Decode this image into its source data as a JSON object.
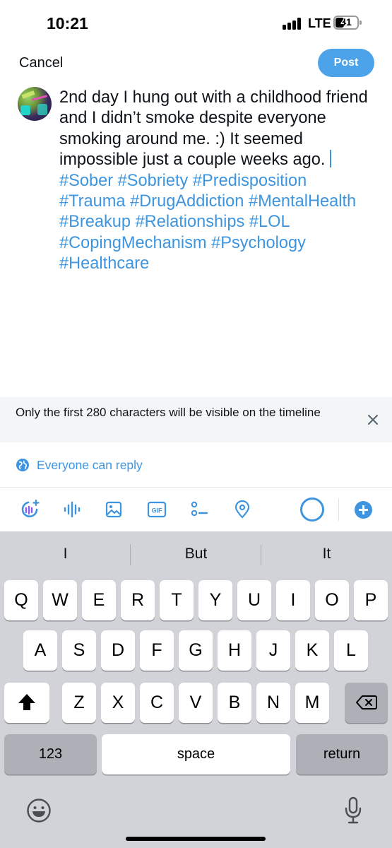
{
  "status_bar": {
    "time": "10:21",
    "network": "LTE",
    "battery_level": "41",
    "battery_fraction": 0.41
  },
  "header": {
    "cancel_label": "Cancel",
    "post_label": "Post"
  },
  "tweet": {
    "text_plain": "2nd day I hung out with a childhood friend and I didn’t smoke despite everyone smoking around me. :) It seemed impossible just a couple weeks ago. ",
    "hashtags": [
      "#Sober",
      "#Sobriety",
      "#Predisposition",
      "#Trauma",
      "#DrugAddiction",
      "#MentalHealth",
      "#Breakup",
      "#Relationships",
      "#LOL",
      "#CopingMechanism",
      "#Psychology",
      "#Healthcare"
    ]
  },
  "notice": {
    "text": "Only the first 280 characters will be visible on the timeline"
  },
  "reply_setting": {
    "label": "Everyone can reply"
  },
  "toolbar": {
    "icons": [
      "grok-icon",
      "audio-wave-icon",
      "image-icon",
      "gif-icon",
      "poll-icon",
      "location-icon",
      "character-progress-icon",
      "add-thread-icon"
    ],
    "gif_label": "GIF",
    "character_progress": 1.0,
    "accent_color": "#3d95e0"
  },
  "keyboard": {
    "suggestions": [
      "I",
      "But",
      "It"
    ],
    "rows": [
      [
        "Q",
        "W",
        "E",
        "R",
        "T",
        "Y",
        "U",
        "I",
        "O",
        "P"
      ],
      [
        "A",
        "S",
        "D",
        "F",
        "G",
        "H",
        "J",
        "K",
        "L"
      ],
      [
        "Z",
        "X",
        "C",
        "V",
        "B",
        "N",
        "M"
      ]
    ],
    "numbers_label": "123",
    "space_label": "space",
    "return_label": "return",
    "icons": [
      "shift-icon",
      "backspace-icon",
      "emoji-icon",
      "microphone-icon"
    ]
  }
}
